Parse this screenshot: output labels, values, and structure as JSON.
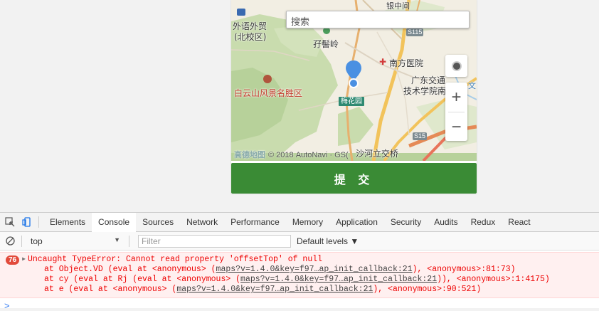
{
  "map": {
    "search_placeholder": "搜索",
    "labels": {
      "top_partial": "银中间",
      "waiyu": "外语外贸",
      "beixiaoqu": "(北校区)",
      "zixiling": "孖髻岭",
      "nanfang": "南方医院",
      "guangdong": "广东交通",
      "jishu": "技术学院南",
      "wen": "文",
      "baiyun": "白云山风景名胜区",
      "meihuayuan": "梅花园",
      "shahe": "沙河立交桥",
      "s115": "S115",
      "s15": "S15"
    },
    "copyright_logo": "高德地图",
    "copyright": "© 2018 AutoNavi · GS(",
    "zoom_in": "+",
    "zoom_out": "−"
  },
  "form": {
    "submit_label": "提 交"
  },
  "devtools": {
    "tabs": [
      "Elements",
      "Console",
      "Sources",
      "Network",
      "Performance",
      "Memory",
      "Application",
      "Security",
      "Audits",
      "Redux",
      "React"
    ],
    "active_tab": "Console",
    "context": "top",
    "filter_placeholder": "Filter",
    "levels": "Default levels ▼",
    "error": {
      "count": "76",
      "message": "Uncaught TypeError: Cannot read property 'offsetTop' of null",
      "stack": [
        {
          "pre": "at Object.VD (eval at <anonymous> (",
          "link": "maps?v=1.4.0&key=f97…ap_init_callback:21",
          "post": "), <anonymous>:81:73)"
        },
        {
          "pre": "at cy (eval at Rj (eval at <anonymous> (",
          "link": "maps?v=1.4.0&key=f97…ap_init_callback:21",
          "post": ")), <anonymous>:1:4175)"
        },
        {
          "pre": "at e (eval at <anonymous> (",
          "link": "maps?v=1.4.0&key=f97…ap_init_callback:21",
          "post": "), <anonymous>:90:521)"
        }
      ]
    },
    "prompt": ">"
  }
}
